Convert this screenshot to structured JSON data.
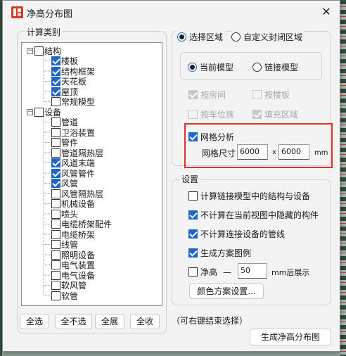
{
  "window": {
    "title": "净高分布图",
    "close_label": "✕"
  },
  "left": {
    "group_label": "计算类别",
    "tree": [
      {
        "label": "结构",
        "level": 0,
        "checked": false,
        "expanded": true
      },
      {
        "label": "楼板",
        "level": 1,
        "checked": true
      },
      {
        "label": "结构框架",
        "level": 1,
        "checked": true
      },
      {
        "label": "天花板",
        "level": 1,
        "checked": true
      },
      {
        "label": "屋顶",
        "level": 1,
        "checked": true
      },
      {
        "label": "常规模型",
        "level": 1,
        "checked": false
      },
      {
        "label": "设备",
        "level": 0,
        "checked": false,
        "expanded": true
      },
      {
        "label": "管道",
        "level": 1,
        "checked": false
      },
      {
        "label": "卫浴装置",
        "level": 1,
        "checked": false
      },
      {
        "label": "管件",
        "level": 1,
        "checked": false
      },
      {
        "label": "管道隔热层",
        "level": 1,
        "checked": false
      },
      {
        "label": "风道末端",
        "level": 1,
        "checked": true
      },
      {
        "label": "风管管件",
        "level": 1,
        "checked": true
      },
      {
        "label": "风管",
        "level": 1,
        "checked": true
      },
      {
        "label": "风管隔热层",
        "level": 1,
        "checked": false
      },
      {
        "label": "机械设备",
        "level": 1,
        "checked": false
      },
      {
        "label": "喷头",
        "level": 1,
        "checked": false
      },
      {
        "label": "电缆桥架配件",
        "level": 1,
        "checked": false
      },
      {
        "label": "电缆桥架",
        "level": 1,
        "checked": false
      },
      {
        "label": "线管",
        "level": 1,
        "checked": false
      },
      {
        "label": "照明设备",
        "level": 1,
        "checked": false
      },
      {
        "label": "电气装置",
        "level": 1,
        "checked": false
      },
      {
        "label": "电气设备",
        "level": 1,
        "checked": false
      },
      {
        "label": "软风管",
        "level": 1,
        "checked": false
      },
      {
        "label": "软管",
        "level": 1,
        "checked": false
      }
    ],
    "buttons": {
      "select_all": "全选",
      "select_none": "全不选",
      "expand_all": "全展",
      "collapse_all": "全收"
    }
  },
  "region": {
    "select_region": "选择区域",
    "custom_region": "自定义封闭区域",
    "current_model": "当前模型",
    "linked_model": "链接模型",
    "by_room": "按房间",
    "by_floor": "按楼板",
    "by_parking": "按车位族",
    "fill_region": "填充区域"
  },
  "grid": {
    "label": "网格分析",
    "size_label": "网格尺寸",
    "x_value": "6000",
    "x_sep": "x",
    "y_value": "6000",
    "unit": "mm"
  },
  "settings": {
    "group_label": "设置",
    "calc_linked": "计算链接模型中的结构与设备",
    "exclude_hidden": "不计算在当前视图中隐藏的构件",
    "exclude_connected_pipes": "不计算连接设备的管线",
    "gen_legend": "生成方案图例",
    "clear_height_prefix": "净高 ",
    "clear_height_dash": "—",
    "clear_height_value": "50",
    "clear_height_suffix": "mm后展示",
    "color_scheme_btn": "颜色方案设置..."
  },
  "footer": {
    "hint": "（可右键结束选择）",
    "generate_btn": "生成净高分布图"
  },
  "colors": {
    "accent": "#1f64c8",
    "highlight": "#e0302b"
  }
}
